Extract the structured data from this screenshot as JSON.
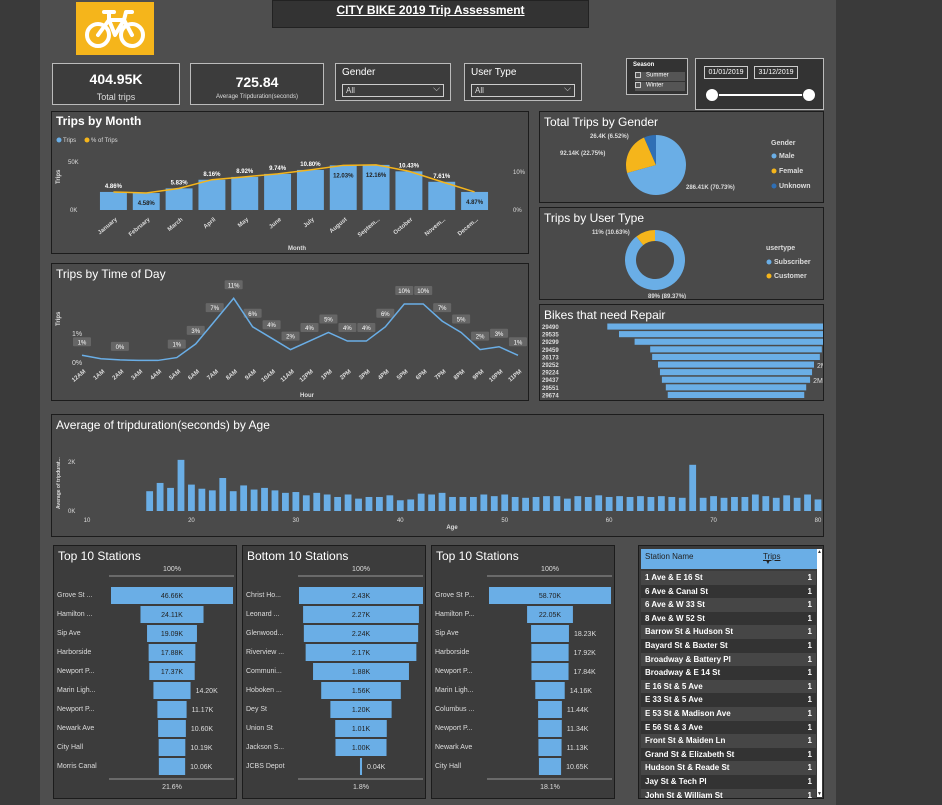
{
  "title": "CITY BIKE 2019 Trip Assessment",
  "brand_color": "#F5B51B",
  "accent": "#6AAEE6",
  "kpis": {
    "total_trips_value": "404.95K",
    "total_trips_label": "Total trips",
    "avg_duration_value": "725.84",
    "avg_duration_label": "Average Tripduration(seconds)"
  },
  "gender_filter": {
    "label": "Gender",
    "value": "All"
  },
  "usertype_filter": {
    "label": "User Type",
    "value": "All"
  },
  "season": {
    "label": "Season",
    "options": [
      "Summer",
      "Winter"
    ]
  },
  "date_range": {
    "start": "01/01/2019",
    "end": "31/12/2019"
  },
  "chart_data": [
    {
      "id": "trips_by_month",
      "type": "bar",
      "title": "Trips by Month",
      "legend": [
        "Trips",
        "% of Trips"
      ],
      "xlabel": "Month",
      "ylabel": "Trips",
      "y_ticks": [
        "50K",
        "0K"
      ],
      "y2_ticks": [
        "10%",
        "0%"
      ],
      "categories": [
        "January",
        "February",
        "March",
        "April",
        "May",
        "June",
        "July",
        "August",
        "Septem...",
        "October",
        "Novem...",
        "Decem..."
      ],
      "series": [
        {
          "name": "Trips",
          "values": [
            19700,
            18500,
            23600,
            33000,
            36100,
            39400,
            43700,
            48700,
            49200,
            42200,
            30800,
            19700
          ]
        },
        {
          "name": "% of Trips",
          "values": [
            4.86,
            4.58,
            5.83,
            8.16,
            8.92,
            9.74,
            10.8,
            12.03,
            12.16,
            10.43,
            7.61,
            4.87
          ],
          "labels": [
            "4.86%",
            "4.58%",
            "5.83%",
            "8.16%",
            "8.92%",
            "9.74%",
            "10.80%",
            "12.03%",
            "12.16%",
            "10.43%",
            "7.61%",
            "4.87%"
          ]
        }
      ]
    },
    {
      "id": "trips_by_gender",
      "type": "pie",
      "title": "Total Trips by Gender",
      "legend_title": "Gender",
      "legend": [
        "Male",
        "Female",
        "Unknown"
      ],
      "values": [
        286.41,
        92.14,
        26.4
      ],
      "labels": [
        "286.41K (70.73%)",
        "92.14K (22.75%)",
        "26.4K (6.52%)"
      ],
      "colors": [
        "#6AAEE6",
        "#F5B51B",
        "#2F6FB5"
      ]
    },
    {
      "id": "trips_by_usertype",
      "type": "pie",
      "title": "Trips by User Type",
      "legend_title": "usertype",
      "legend": [
        "Subscriber",
        "Customer"
      ],
      "values": [
        89.37,
        10.63
      ],
      "labels": [
        "89% (89.37%)",
        "11% (10.63%)"
      ],
      "colors": [
        "#6AAEE6",
        "#F5B51B"
      ]
    },
    {
      "id": "trips_by_time",
      "type": "line",
      "title": "Trips by Time of Day",
      "xlabel": "Hour",
      "ylabel": "Trips",
      "y_ticks": [
        "1%",
        "0%"
      ],
      "categories": [
        "12AM",
        "1AM",
        "2AM",
        "3AM",
        "4AM",
        "5AM",
        "6AM",
        "7AM",
        "8AM",
        "9AM",
        "10AM",
        "11AM",
        "12PM",
        "1PM",
        "2PM",
        "3PM",
        "4PM",
        "5PM",
        "6PM",
        "7PM",
        "8PM",
        "9PM",
        "10PM",
        "11PM"
      ],
      "values": [
        1,
        0.4,
        0.2,
        0.1,
        0.1,
        0.6,
        3,
        7,
        11,
        6,
        4,
        2,
        3.5,
        5,
        3.5,
        3.5,
        6,
        10,
        10,
        7,
        5,
        2,
        2.5,
        1
      ],
      "labels": [
        "1%",
        "",
        "0%",
        "",
        "",
        "1%",
        "3%",
        "7%",
        "11%",
        "6%",
        "4%",
        "2%",
        "4%",
        "5%",
        "4%",
        "4%",
        "6%",
        "10%",
        "10%",
        "7%",
        "5%",
        "2%",
        "3%",
        "1%"
      ]
    },
    {
      "id": "bikes_need_repair",
      "type": "bar",
      "title": "Bikes that need Repair",
      "categories": [
        "29490",
        "29535",
        "29299",
        "29459",
        "26173",
        "29252",
        "29224",
        "29437",
        "29551",
        "29674"
      ],
      "values": [
        3.3,
        3.0,
        2.6,
        2.2,
        2.15,
        2.0,
        1.95,
        1.9,
        1.8,
        1.75
      ],
      "labels": [
        "",
        "3M",
        "",
        "2M",
        "",
        "2M",
        "",
        "2M",
        "",
        ""
      ]
    },
    {
      "id": "avg_duration_by_age",
      "type": "bar",
      "title": "Average of tripduration(seconds) by Age",
      "xlabel": "Age",
      "ylabel": "Average of tripdurat...",
      "y_ticks": [
        "2K",
        "0K"
      ],
      "x_ticks": [
        "10",
        "20",
        "30",
        "40",
        "50",
        "60",
        "70",
        "80"
      ],
      "x_start": 16,
      "values": [
        1200,
        1700,
        1400,
        3100,
        1600,
        1350,
        1250,
        2000,
        1200,
        1550,
        1300,
        1400,
        1250,
        1100,
        1150,
        950,
        1100,
        1000,
        850,
        1000,
        750,
        850,
        850,
        950,
        650,
        700,
        1050,
        1000,
        1100,
        850,
        850,
        850,
        1000,
        900,
        1000,
        850,
        800,
        850,
        900,
        900,
        750,
        900,
        850,
        950,
        850,
        900,
        850,
        900,
        850,
        900,
        850,
        800,
        2800,
        800,
        900,
        800,
        850,
        850,
        1000,
        900,
        800,
        950,
        800,
        1000,
        700,
        700,
        700,
        1000,
        800,
        1000,
        700,
        1200,
        1050,
        700,
        1100,
        2400,
        1200,
        1000,
        1000,
        700,
        1200
      ]
    },
    {
      "id": "top10_a",
      "type": "bar",
      "title": "Top 10 Stations",
      "top_label": "100%",
      "bottom_label": "21.6%",
      "categories": [
        "Grove St ...",
        "Hamilton ...",
        "Sip Ave",
        "Harborside",
        "Newport P...",
        "Marin Ligh...",
        "Newport P...",
        "Newark Ave",
        "City Hall",
        "Morris Canal"
      ],
      "values": [
        46.66,
        24.11,
        19.09,
        17.88,
        17.37,
        14.2,
        11.17,
        10.6,
        10.19,
        10.06
      ],
      "labels": [
        "46.66K",
        "24.11K",
        "19.09K",
        "17.88K",
        "17.37K",
        "14.20K",
        "11.17K",
        "10.60K",
        "10.19K",
        "10.06K"
      ]
    },
    {
      "id": "bottom10",
      "type": "bar",
      "title": "Bottom 10 Stations",
      "top_label": "100%",
      "bottom_label": "1.8%",
      "categories": [
        "Christ Ho...",
        "Leonard ...",
        "Glenwood...",
        "Riverview ...",
        "Communi...",
        "Hoboken ...",
        "Dey St",
        "Union St",
        "Jackson S...",
        "JCBS Depot"
      ],
      "values": [
        2.43,
        2.27,
        2.24,
        2.17,
        1.88,
        1.56,
        1.2,
        1.01,
        1.0,
        0.04
      ],
      "labels": [
        "2.43K",
        "2.27K",
        "2.24K",
        "2.17K",
        "1.88K",
        "1.56K",
        "1.20K",
        "1.01K",
        "1.00K",
        "0.04K"
      ]
    },
    {
      "id": "top10_b",
      "type": "bar",
      "title": "Top 10 Stations",
      "top_label": "100%",
      "bottom_label": "18.1%",
      "categories": [
        "Grove St P...",
        "Hamilton P...",
        "Sip Ave",
        "Harborside",
        "Newport P...",
        "Marin Ligh...",
        "Columbus ...",
        "Newport P...",
        "Newark Ave",
        "City Hall"
      ],
      "values": [
        58.7,
        22.05,
        18.23,
        17.92,
        17.84,
        14.16,
        11.44,
        11.34,
        11.13,
        10.65
      ],
      "labels": [
        "58.70K",
        "22.05K",
        "18.23K",
        "17.92K",
        "17.84K",
        "14.16K",
        "11.44K",
        "11.34K",
        "11.13K",
        "10.65K"
      ]
    }
  ],
  "station_table": {
    "headers": [
      "Station Name",
      "Trips"
    ],
    "rows": [
      [
        "1 Ave & E 16 St",
        "1"
      ],
      [
        "6 Ave & Canal St",
        "1"
      ],
      [
        "6 Ave & W 33 St",
        "1"
      ],
      [
        "8 Ave & W 52 St",
        "1"
      ],
      [
        "Barrow St & Hudson St",
        "1"
      ],
      [
        "Bayard St & Baxter St",
        "1"
      ],
      [
        "Broadway & Battery Pl",
        "1"
      ],
      [
        "Broadway & E 14 St",
        "1"
      ],
      [
        "E 16 St & 5 Ave",
        "1"
      ],
      [
        "E 33 St & 5 Ave",
        "1"
      ],
      [
        "E 53 St & Madison Ave",
        "1"
      ],
      [
        "E 56 St & 3 Ave",
        "1"
      ],
      [
        "Front St & Maiden Ln",
        "1"
      ],
      [
        "Grand St & Elizabeth St",
        "1"
      ],
      [
        "Hudson St & Reade St",
        "1"
      ],
      [
        "Jay St & Tech Pl",
        "1"
      ],
      [
        "John St & William St",
        "1"
      ]
    ]
  }
}
